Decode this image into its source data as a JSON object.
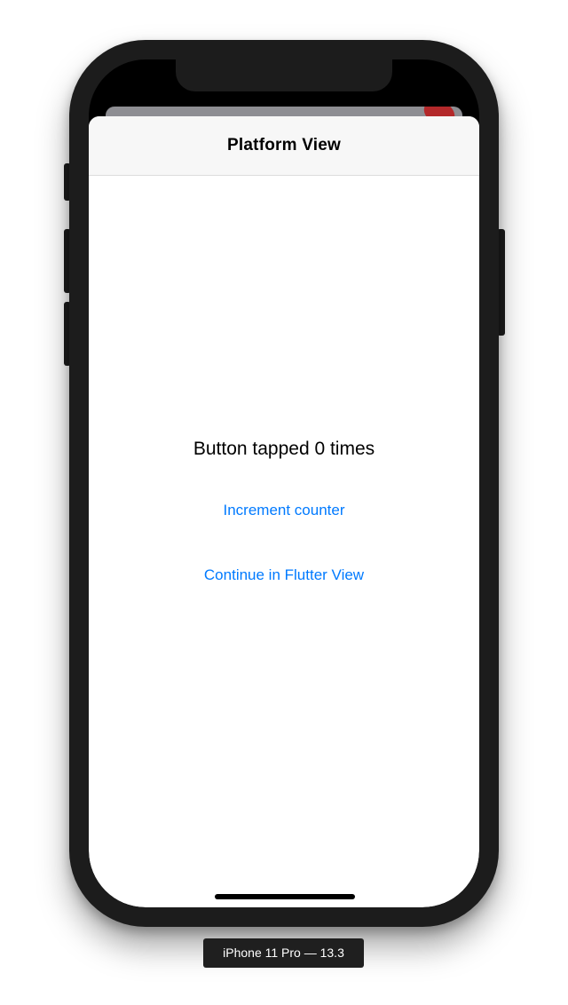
{
  "navigation": {
    "title": "Platform View"
  },
  "main": {
    "counter_text": "Button tapped 0 times",
    "increment_label": "Increment counter",
    "continue_label": "Continue in Flutter View"
  },
  "device": {
    "label": "iPhone 11 Pro — 13.3"
  },
  "colors": {
    "accent": "#007aff",
    "frame": "#1c1c1c",
    "nav_background": "#f7f7f7"
  }
}
